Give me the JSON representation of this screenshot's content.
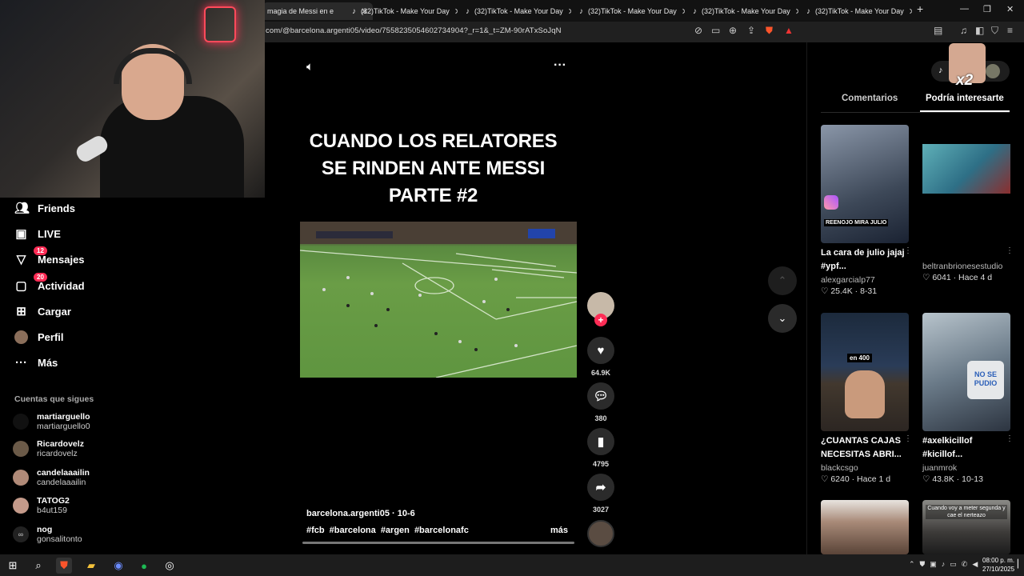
{
  "browser": {
    "tabs": [
      {
        "label": "magia de Messi en e",
        "active": true
      },
      {
        "label": "(32)TikTok - Make Your Day",
        "active": false
      },
      {
        "label": "(32)TikTok - Make Your Day",
        "active": false
      },
      {
        "label": "(32)TikTok - Make Your Day",
        "active": false
      },
      {
        "label": "(32)TikTok - Make Your Day",
        "active": false
      },
      {
        "label": "(32)TikTok - Make Your Day",
        "active": false
      }
    ],
    "url": "com/@barcelona.argenti05/video/7558235054602734904?_r=1&_t=ZM-90rATxSoJqN"
  },
  "sidebar": {
    "nav": [
      {
        "label": "Friends",
        "icon": "friends-icon",
        "badge": ""
      },
      {
        "label": "LIVE",
        "icon": "live-icon",
        "badge": ""
      },
      {
        "label": "Mensajes",
        "icon": "messages-icon",
        "badge": "12"
      },
      {
        "label": "Actividad",
        "icon": "activity-icon",
        "badge": "20"
      },
      {
        "label": "Cargar",
        "icon": "upload-icon",
        "badge": ""
      },
      {
        "label": "Perfil",
        "icon": "profile-icon",
        "badge": ""
      },
      {
        "label": "Más",
        "icon": "more-icon",
        "badge": ""
      }
    ],
    "following_title": "Cuentas que sigues",
    "following": [
      {
        "name": "martiarguello",
        "handle": "martiarguello0"
      },
      {
        "name": "Ricardovelz",
        "handle": "ricardovelz"
      },
      {
        "name": "candelaaailin",
        "handle": "candelaaailin"
      },
      {
        "name": "TATOG2",
        "handle": "b4ut159"
      },
      {
        "name": "nog",
        "handle": "gonsalitonto"
      }
    ]
  },
  "video": {
    "caption_lines": [
      "CUANDO LOS RELATORES",
      "SE RINDEN ANTE MESSI",
      "PARTE #2"
    ],
    "author_line": "barcelona.argenti05 · 10-6",
    "tags": "#fcb #barcelona #argen #barcelonafc",
    "more": "más",
    "likes": "64.9K",
    "comments": "380",
    "saves": "4795",
    "shares": "3027"
  },
  "right_panel": {
    "tabs": [
      "Comentarios",
      "Podría interesarte"
    ],
    "badge": "x2",
    "cards": [
      {
        "title": "La cara de julio jajaj #ypf...",
        "user": "alexgarcialp77",
        "stats": "♡ 25.4K · 8-31",
        "thumb_text": "REENOJO MIRA JULIO"
      },
      {
        "title": "",
        "user": "beltranbrionesestudio",
        "stats": "♡ 6041 · Hace 4 d",
        "thumb_text": ""
      },
      {
        "title": "¿CUANTAS CAJAS NECESITAS ABRI...",
        "user": "blackcsgo",
        "stats": "♡ 6240 · Hace 1 d",
        "thumb_text": "en 400"
      },
      {
        "title": "#axelkicillof #kicillof...",
        "user": "juanmrok",
        "stats": "♡ 43.8K · 10-13",
        "thumb_text": "NO SE PUDIO"
      },
      {
        "title": "",
        "user": "",
        "stats": "",
        "thumb_text": ""
      },
      {
        "title": "",
        "user": "",
        "stats": "",
        "thumb_text": "Cuando voy a meter segunda y cae el nerteazo"
      }
    ]
  },
  "taskbar": {
    "time": "08:00 p. m.",
    "date": "27/10/2025"
  },
  "colors": {
    "accent": "#fe2c55",
    "background": "#000000"
  }
}
